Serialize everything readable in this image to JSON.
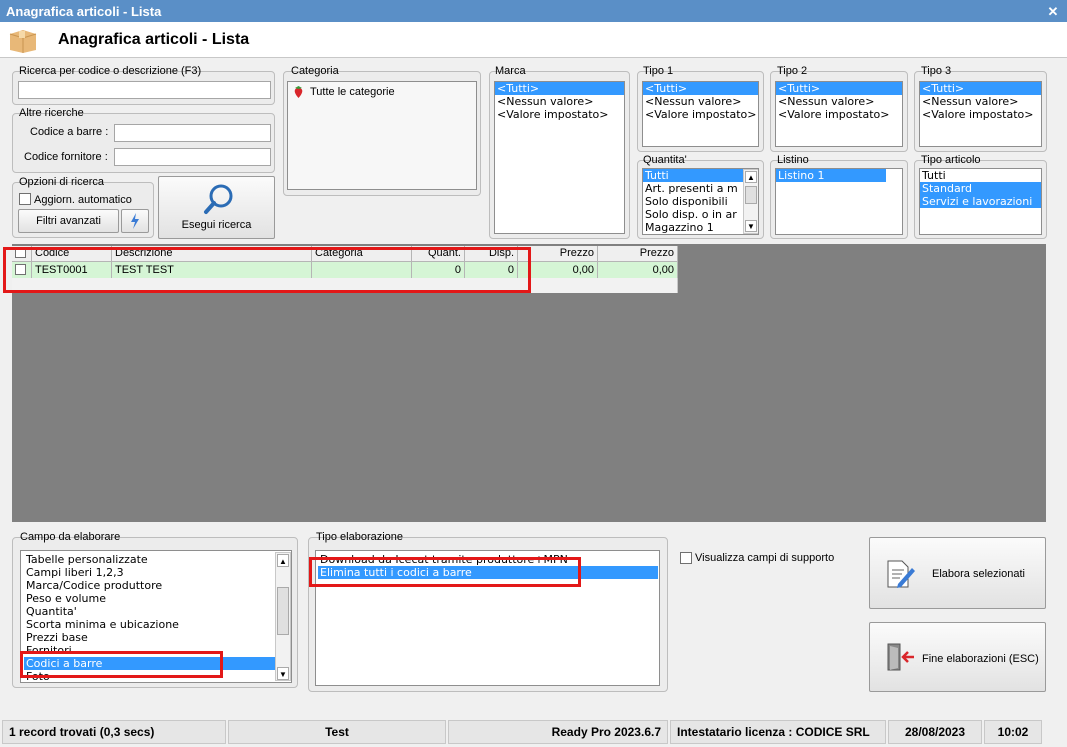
{
  "window": {
    "title": "Anagrafica articoli  - Lista",
    "close": "✕"
  },
  "header": {
    "title": "Anagrafica articoli  - Lista"
  },
  "search": {
    "label": "Ricerca per codice o descrizione (F3)",
    "value": ""
  },
  "altre": {
    "label": "Altre ricerche",
    "barcode_label": "Codice a barre :",
    "supplier_label": "Codice fornitore :"
  },
  "opzioni": {
    "label": "Opzioni di ricerca",
    "auto_update": "Aggiorn. automatico",
    "filters_button": "Filtri avanzati",
    "search_button": "Esegui ricerca"
  },
  "categoria": {
    "label": "Categoria",
    "item": "Tutte le categorie"
  },
  "marca": {
    "label": "Marca",
    "items": [
      "<Tutti>",
      "<Nessun valore>",
      "<Valore impostato>"
    ]
  },
  "tipo1": {
    "label": "Tipo 1",
    "items": [
      "<Tutti>",
      "<Nessun valore>",
      "<Valore impostato>"
    ]
  },
  "tipo2": {
    "label": "Tipo 2",
    "items": [
      "<Tutti>",
      "<Nessun valore>",
      "<Valore impostato>"
    ]
  },
  "tipo3": {
    "label": "Tipo 3",
    "items": [
      "<Tutti>",
      "<Nessun valore>",
      "<Valore impostato>"
    ]
  },
  "quantita": {
    "label": "Quantita'",
    "items": [
      "Tutti",
      "Art. presenti a m",
      "Solo disponibili",
      "Solo disp. o in ar",
      "Magazzino 1"
    ]
  },
  "listino": {
    "label": "Listino",
    "items": [
      "Listino 1"
    ]
  },
  "tipo_articolo": {
    "label": "Tipo articolo",
    "items": [
      "Tutti",
      "Standard",
      "Servizi e lavorazioni"
    ]
  },
  "grid": {
    "headers": [
      "Codice",
      "Descrizione",
      "Categoria",
      "Quant.",
      "Disp.",
      "Prezzo",
      "Prezzo"
    ],
    "row": [
      "TEST0001",
      "TEST TEST",
      "",
      "0",
      "0",
      "0,00",
      "0,00"
    ]
  },
  "campo": {
    "label": "Campo da elaborare",
    "items": [
      "Tabelle personalizzate",
      "Campi liberi 1,2,3",
      "Marca/Codice produttore",
      "Peso e volume",
      "Quantita'",
      "Scorta minima e ubicazione",
      "Prezzi base",
      "Fornitori",
      "Codici a barre",
      "Foto"
    ]
  },
  "tipo_elab": {
    "label": "Tipo elaborazione",
    "items": [
      "Download da Icecat tramite produttore+MPN",
      "Elimina tutti i codici a barre"
    ]
  },
  "support": {
    "label": "Visualizza campi di supporto"
  },
  "actions": {
    "process": "Elabora selezionati",
    "end": "Fine elaborazioni (ESC)"
  },
  "statusbar": {
    "records": "1 record trovati (0,3 secs)",
    "db": "Test",
    "version": "Ready Pro 2023.6.7",
    "license": "Intestatario licenza : CODICE SRL",
    "date": "28/08/2023",
    "time": "10:02"
  },
  "colors": {
    "selection": "#3399ff",
    "title_bar": "#5a8fc7",
    "grid_row": "#d5f5d5",
    "highlight": "#e31818"
  }
}
